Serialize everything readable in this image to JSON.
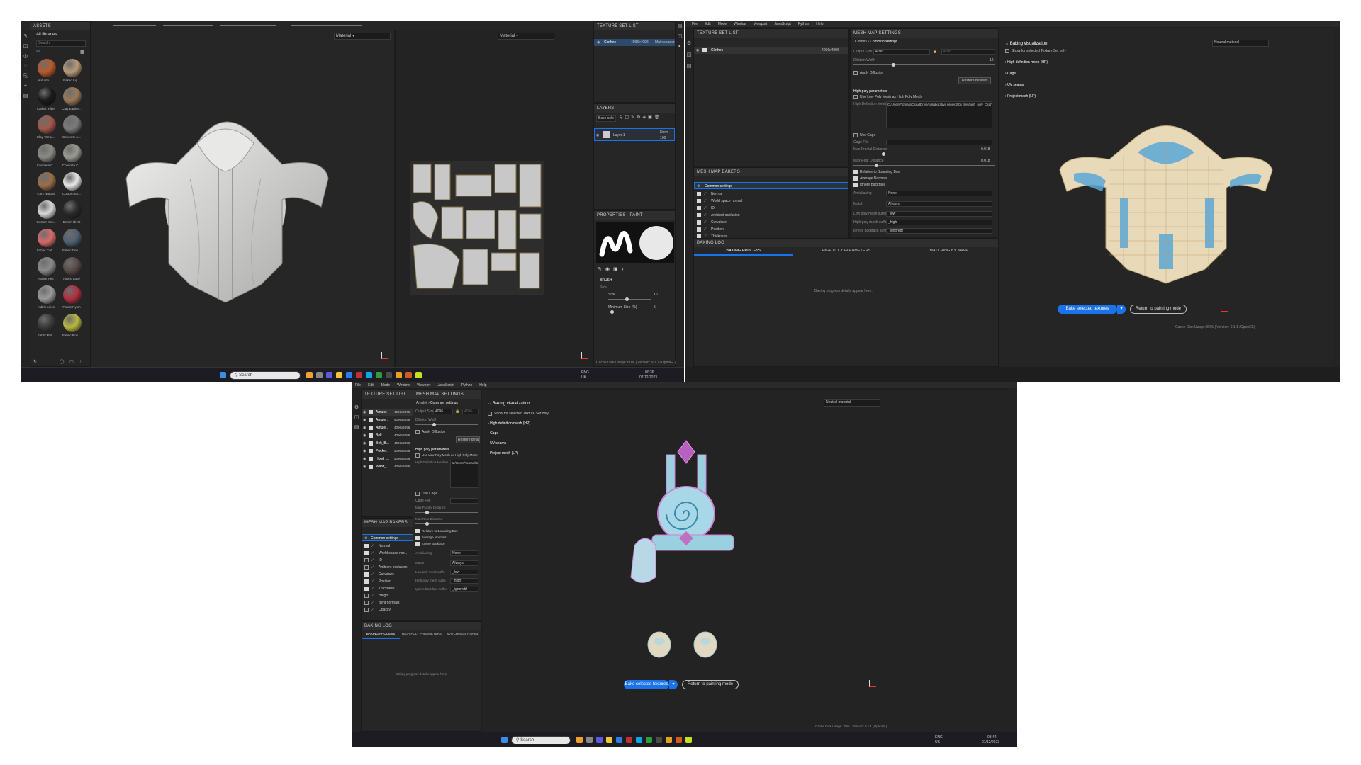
{
  "shot1": {
    "assets": {
      "title": "ASSETS",
      "all_libraries": "All libraries",
      "search_placeholder": "Search",
      "materials": [
        {
          "name": "Autumn L...",
          "color": "#b85a2a"
        },
        {
          "name": "Baked Lig...",
          "color": "#b89a7a"
        },
        {
          "name": "Carbon Fiber",
          "color": "#1a1a1a"
        },
        {
          "name": "Clay Earthe...",
          "color": "#9a7858"
        },
        {
          "name": "Clay Terrac...",
          "color": "#a0584a"
        },
        {
          "name": "Concrete A...",
          "color": "#7a7a7a"
        },
        {
          "name": "Concrete C...",
          "color": "#8a8a86"
        },
        {
          "name": "Concrete C...",
          "color": "#9a9a92"
        },
        {
          "name": "Cork Natural",
          "color": "#9a6e48"
        },
        {
          "name": "Custom Sp...",
          "color": "#e8e8e8"
        },
        {
          "name": "Custom Sm...",
          "color": "#d8d8d8"
        },
        {
          "name": "Denim Rivet",
          "color": "#2a2a2a"
        },
        {
          "name": "Fabric Cott...",
          "color": "#d86a6a"
        },
        {
          "name": "Fabric Den...",
          "color": "#506070"
        },
        {
          "name": "Fabric Felt",
          "color": "#8a8a8a"
        },
        {
          "name": "Fabric Lace",
          "color": "#5a4a4a"
        },
        {
          "name": "Fabric Linen",
          "color": "#9a9a9a"
        },
        {
          "name": "Fabric Nylon",
          "color": "#b03040"
        },
        {
          "name": "Fabric Pol...",
          "color": "#3a3a3a"
        },
        {
          "name": "Fabric Rou...",
          "color": "#b8b840"
        }
      ]
    },
    "viewport_3d": {
      "shader": "Material"
    },
    "viewport_2d": {
      "shader": "Material"
    },
    "texture_set_list": {
      "title": "TEXTURE SET LIST",
      "rows": [
        {
          "name": "Clothes",
          "size": "4096x4096",
          "shader": "Main shader"
        }
      ]
    },
    "layers": {
      "title": "LAYERS",
      "channel": "Base colo",
      "layer_name": "Layer 1",
      "blend": "Norm",
      "opacity": "100"
    },
    "properties": {
      "title": "PROPERTIES - PAINT",
      "section": "BRUSH",
      "size_label": "Size",
      "size_field": "Size",
      "size_value": "10",
      "minsize_label": "Minimum Size (%)",
      "minsize_value": "5"
    },
    "status": {
      "text": "Cache Disk Usage: 80% | Version: 9.1.1 (OpenGL)"
    },
    "taskbar": {
      "search": "Search",
      "lang": "ENG",
      "region": "UK",
      "time": "00:36",
      "date": "07/12/2023"
    }
  },
  "shot2": {
    "menu": [
      "File",
      "Edit",
      "Mode",
      "Window",
      "Viewport",
      "JavaScript",
      "Python",
      "Help"
    ],
    "texture_set_list": {
      "title": "TEXTURE SET LIST",
      "rows": [
        {
          "name": "Clothes",
          "size": "4096x4096"
        }
      ]
    },
    "mesh_map_settings": {
      "title": "MESH MAP SETTINGS",
      "breadcrumb_a": "Clothes",
      "breadcrumb_b": "Common settings",
      "output_size_label": "Output Size",
      "output_size_value": "4096",
      "output_size_locked": "4096",
      "dilation_label": "Dilation Width",
      "dilation_value": "12",
      "apply_diffusion": "Apply Diffusion",
      "restore_defaults": "Restore defaults",
      "high_poly_header": "High poly parameters",
      "use_low_poly": "Use Low Poly Mesh as High Poly Mesh",
      "hd_meshes_label": "High Definition Meshes",
      "hd_meshes_value": "C:/Users/Tomas/iCloudDrive/collaborative project/fbx files/high_poly_Clothes.fbx",
      "use_cage": "Use Cage",
      "cage_file": "Cage File",
      "max_frontal_label": "Max Frontal Distance",
      "max_frontal_value": "0.018",
      "max_rear_label": "Max Rear Distance",
      "max_rear_value": "0.018",
      "relative_bbox": "Relative to Bounding Box",
      "average_normals": "Average Normals",
      "ignore_backface": "Ignore Backface",
      "antialiasing_label": "Antialiasing",
      "antialiasing_value": "None",
      "match_label": "Match",
      "match_value": "Always",
      "low_suffix_label": "Low poly mesh suffix",
      "low_suffix_value": "_low",
      "high_suffix_label": "High poly mesh suffix",
      "high_suffix_value": "_high",
      "ignore_suffix_label": "Ignore backface suffix",
      "ignore_suffix_value": "_ignorebf"
    },
    "mesh_map_bakers": {
      "title": "MESH MAP BAKERS",
      "common": "Common settings",
      "items": [
        {
          "label": "Normal",
          "on": true
        },
        {
          "label": "World space normal",
          "on": true
        },
        {
          "label": "ID",
          "on": true
        },
        {
          "label": "Ambient occlusion",
          "on": true
        },
        {
          "label": "Curvature",
          "on": true
        },
        {
          "label": "Position",
          "on": true
        },
        {
          "label": "Thickness",
          "on": true
        },
        {
          "label": "Height",
          "on": false
        },
        {
          "label": "Bent normals",
          "on": false
        },
        {
          "label": "Opacity",
          "on": false
        }
      ]
    },
    "baking_log": {
      "title": "BAKING LOG",
      "tabs": [
        "BAKING PROCESS",
        "HIGH POLY PARAMETERS",
        "MATCHING BY NAME"
      ],
      "empty": "Baking progress details appear here."
    },
    "viz": {
      "header": "Baking visualization",
      "show_selected": "Show for selected Texture Set only",
      "sections": [
        "High definition mesh (HP)",
        "Cage",
        "UV seams",
        "Project mesh (LP)"
      ],
      "material": "Neutral material"
    },
    "buttons": {
      "bake": "Bake selected textures",
      "return": "Return to painting mode"
    },
    "status": {
      "text": "Cache Disk Usage: 80% | Version: 9.1.1 (OpenGL)"
    }
  },
  "shot3": {
    "menu": [
      "File",
      "Edit",
      "Mode",
      "Window",
      "Viewport",
      "JavaScript",
      "Python",
      "Help"
    ],
    "texture_set_list": {
      "title": "TEXTURE SET LIST",
      "rows": [
        {
          "name": "Amulet",
          "size": "4096x4096"
        },
        {
          "name": "Amule...",
          "size": "4096x4096"
        },
        {
          "name": "Amule...",
          "size": "4096x4096"
        },
        {
          "name": "Belt",
          "size": "4096x4096"
        },
        {
          "name": "Belt_B...",
          "size": "4096x4096"
        },
        {
          "name": "Pocke...",
          "size": "4096x4096"
        },
        {
          "name": "Hood_...",
          "size": "4096x4096"
        },
        {
          "name": "Waist_...",
          "size": "4096x4096"
        }
      ]
    },
    "mesh_map_settings": {
      "title": "MESH MAP SETTINGS",
      "breadcrumb_a": "Amulet",
      "breadcrumb_b": "Common settings",
      "output_size_label": "Output Size",
      "output_size_value": "4096",
      "output_size_locked": "4096",
      "dilation_label": "Dilation Width",
      "apply_diffusion": "Apply Diffusion",
      "restore_defaults": "Restore defau",
      "high_poly_header": "High poly parameters",
      "use_low_poly": "Use Low Poly Mesh as High Poly Mesh",
      "hd_meshes_label": "High Definition Meshes",
      "hd_meshes_value": "C:/Users/Tomas/iC",
      "use_cage": "Use Cage",
      "cage_file": "Cage File",
      "max_frontal_label": "Max Frontal Distance",
      "max_rear_label": "Max Rear Distance",
      "relative_bbox": "Relative to Bounding Box",
      "average_normals": "Average Normals",
      "ignore_backface": "Ignore Backface",
      "antialiasing_label": "Antialiasing",
      "antialiasing_value": "None",
      "match_label": "Match",
      "match_value": "Always",
      "low_suffix_label": "Low poly mesh suffix",
      "low_suffix_value": "_low",
      "high_suffix_label": "High poly mesh suffix",
      "high_suffix_value": "_high",
      "ignore_suffix_label": "Ignore backface suffix",
      "ignore_suffix_value": "_ignorebf"
    },
    "mesh_map_bakers": {
      "title": "MESH MAP BAKERS",
      "common": "Common settings",
      "items": [
        {
          "label": "Normal",
          "on": true
        },
        {
          "label": "World space nor...",
          "on": true
        },
        {
          "label": "ID",
          "on": false
        },
        {
          "label": "Ambient occlusion",
          "on": false
        },
        {
          "label": "Curvature",
          "on": true
        },
        {
          "label": "Position",
          "on": true
        },
        {
          "label": "Thickness",
          "on": true
        },
        {
          "label": "Height",
          "on": false
        },
        {
          "label": "Bent normals",
          "on": false
        },
        {
          "label": "Opacity",
          "on": false
        }
      ]
    },
    "baking_log": {
      "title": "BAKING LOG",
      "tabs": [
        "BAKING PROCESS",
        "HIGH POLY PARAMETERS",
        "MATCHING BY NAME"
      ],
      "empty": "Baking progress details appear here."
    },
    "viz": {
      "header": "Baking visualization",
      "show_selected": "Show for selected Texture Set only",
      "sections": [
        "High definition mesh (HP)",
        "Cage",
        "UV seams",
        "Project mesh (LP)"
      ],
      "material": "Neutral material"
    },
    "buttons": {
      "bake": "Bake selected textures",
      "return": "Return to painting mode"
    },
    "status": {
      "text": "Cache Disk Usage: 79% | Version: 9.1.1 (OpenGL)"
    },
    "taskbar": {
      "search": "Search",
      "lang": "ENG",
      "region": "UK",
      "time": "03:42",
      "date": "01/12/2023"
    }
  }
}
